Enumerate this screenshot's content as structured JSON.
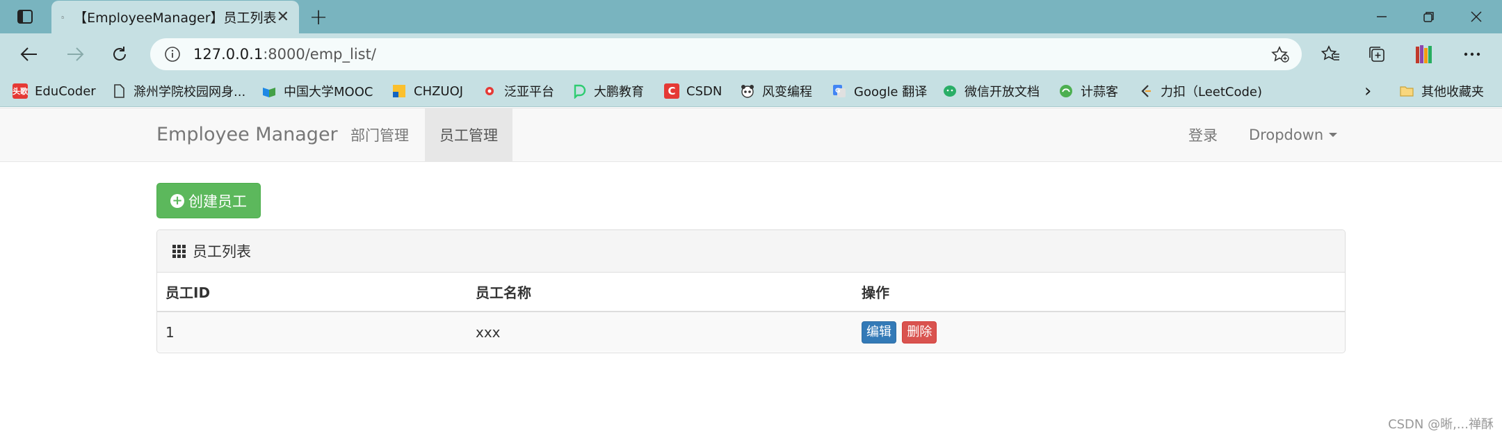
{
  "browser": {
    "tab_title": "【EmployeeManager】员工列表",
    "tab_close": "✕",
    "new_tab": "+",
    "url_host": "127.0.0.1",
    "url_rest": ":8000/emp_list/"
  },
  "bookmarks": [
    {
      "label": "EduCoder",
      "icon": "头歌",
      "color": "#e53935"
    },
    {
      "label": "滁州学院校园网身...",
      "icon": "",
      "color": "transparent"
    },
    {
      "label": "中国大学MOOC",
      "icon": "",
      "color": "#1e88e5"
    },
    {
      "label": "CHZUOJ",
      "icon": "",
      "color": "#fbc02d"
    },
    {
      "label": "泛亚平台",
      "icon": "",
      "color": "#e53935"
    },
    {
      "label": "大鹏教育",
      "icon": "",
      "color": "#2ecc71"
    },
    {
      "label": "CSDN",
      "icon": "C",
      "color": "#e53935"
    },
    {
      "label": "风变编程",
      "icon": "",
      "color": "#555555"
    },
    {
      "label": "Google 翻译",
      "icon": "",
      "color": "#4285f4"
    },
    {
      "label": "微信开放文档",
      "icon": "",
      "color": "#2aae67"
    },
    {
      "label": "计蒜客",
      "icon": "",
      "color": "#4caf50"
    },
    {
      "label": "力扣（LeetCode)",
      "icon": "",
      "color": "#f0a030"
    }
  ],
  "bookmarks_more": "›",
  "other_favorites": "其他收藏夹",
  "app": {
    "brand": "Employee Manager",
    "nav": [
      "部门管理",
      "员工管理"
    ],
    "login": "登录",
    "dropdown": "Dropdown"
  },
  "create_button": "创建员工",
  "panel": {
    "title": "员工列表",
    "columns": [
      "员工ID",
      "员工名称",
      "操作"
    ],
    "rows": [
      {
        "id": "1",
        "name": "xxx"
      }
    ],
    "edit_label": "编辑",
    "delete_label": "删除"
  },
  "watermark": "CSDN @晰,...禅酥"
}
